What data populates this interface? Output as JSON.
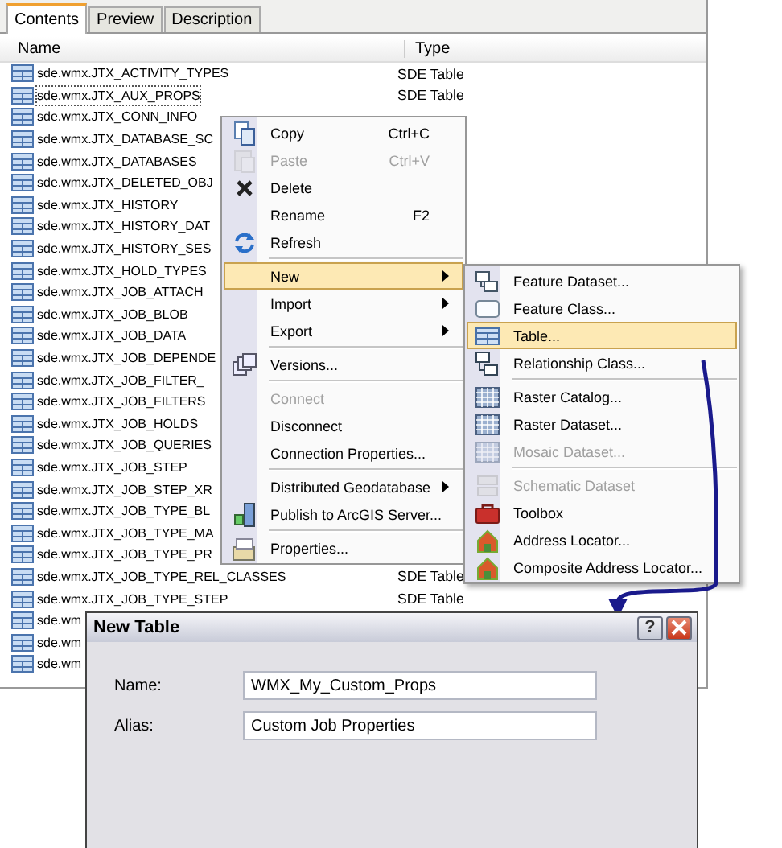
{
  "explorer": {
    "tabs": [
      {
        "label": "Contents",
        "selected": true
      },
      {
        "label": "Preview",
        "selected": false
      },
      {
        "label": "Description",
        "selected": false
      }
    ],
    "columns": [
      "Name",
      "Type"
    ],
    "rows": [
      {
        "name": "sde.wmx.JTX_ACTIVITY_TYPES",
        "type": "SDE Table",
        "focused": false
      },
      {
        "name": "sde.wmx.JTX_AUX_PROPS",
        "type": "SDE Table",
        "focused": true
      },
      {
        "name": "sde.wmx.JTX_CONN_INFO",
        "focused": false
      },
      {
        "name": "sde.wmx.JTX_DATABASE_SC",
        "focused": false
      },
      {
        "name": "sde.wmx.JTX_DATABASES",
        "focused": false
      },
      {
        "name": "sde.wmx.JTX_DELETED_OBJ",
        "focused": false
      },
      {
        "name": "sde.wmx.JTX_HISTORY",
        "focused": false
      },
      {
        "name": "sde.wmx.JTX_HISTORY_DAT",
        "focused": false
      },
      {
        "name": "sde.wmx.JTX_HISTORY_SES",
        "focused": false
      },
      {
        "name": "sde.wmx.JTX_HOLD_TYPES",
        "focused": false
      },
      {
        "name": "sde.wmx.JTX_JOB_ATTACH",
        "focused": false
      },
      {
        "name": "sde.wmx.JTX_JOB_BLOB",
        "focused": false
      },
      {
        "name": "sde.wmx.JTX_JOB_DATA",
        "focused": false
      },
      {
        "name": "sde.wmx.JTX_JOB_DEPENDE",
        "focused": false
      },
      {
        "name": "sde.wmx.JTX_JOB_FILTER_",
        "focused": false
      },
      {
        "name": "sde.wmx.JTX_JOB_FILTERS",
        "focused": false
      },
      {
        "name": "sde.wmx.JTX_JOB_HOLDS",
        "focused": false
      },
      {
        "name": "sde.wmx.JTX_JOB_QUERIES",
        "focused": false
      },
      {
        "name": "sde.wmx.JTX_JOB_STEP",
        "focused": false
      },
      {
        "name": "sde.wmx.JTX_JOB_STEP_XR",
        "focused": false
      },
      {
        "name": "sde.wmx.JTX_JOB_TYPE_BL",
        "focused": false
      },
      {
        "name": "sde.wmx.JTX_JOB_TYPE_MA",
        "focused": false
      },
      {
        "name": "sde.wmx.JTX_JOB_TYPE_PR",
        "focused": false
      },
      {
        "name": "sde.wmx.JTX_JOB_TYPE_REL_CLASSES",
        "type": "SDE Table",
        "focused": false
      },
      {
        "name": "sde.wmx.JTX_JOB_TYPE_STEP",
        "type": "SDE Table",
        "focused": false
      },
      {
        "name": "sde.wm",
        "focused": false
      },
      {
        "name": "sde.wm",
        "focused": false
      },
      {
        "name": "sde.wm",
        "focused": false
      }
    ]
  },
  "context_menu": {
    "items": [
      {
        "kind": "item",
        "label": "Copy",
        "shortcut": "Ctrl+C",
        "disabled": false,
        "selected": false,
        "submenu": false
      },
      {
        "kind": "item",
        "label": "Paste",
        "shortcut": "Ctrl+V",
        "disabled": true,
        "selected": false,
        "submenu": false
      },
      {
        "kind": "item",
        "label": "Delete",
        "disabled": false,
        "selected": false,
        "submenu": false
      },
      {
        "kind": "item",
        "label": "Rename",
        "shortcut": "F2",
        "disabled": false,
        "selected": false,
        "submenu": false
      },
      {
        "kind": "item",
        "label": "Refresh",
        "disabled": false,
        "selected": false,
        "submenu": false
      },
      {
        "kind": "separator"
      },
      {
        "kind": "item",
        "label": "New",
        "disabled": false,
        "selected": true,
        "submenu": true
      },
      {
        "kind": "item",
        "label": "Import",
        "disabled": false,
        "selected": false,
        "submenu": true
      },
      {
        "kind": "item",
        "label": "Export",
        "disabled": false,
        "selected": false,
        "submenu": true
      },
      {
        "kind": "separator"
      },
      {
        "kind": "item",
        "label": "Versions...",
        "disabled": false,
        "selected": false,
        "submenu": false
      },
      {
        "kind": "separator"
      },
      {
        "kind": "item",
        "label": "Connect",
        "disabled": true,
        "selected": false,
        "submenu": false
      },
      {
        "kind": "item",
        "label": "Disconnect",
        "disabled": false,
        "selected": false,
        "submenu": false
      },
      {
        "kind": "item",
        "label": "Connection Properties...",
        "disabled": false,
        "selected": false,
        "submenu": false
      },
      {
        "kind": "separator"
      },
      {
        "kind": "item",
        "label": "Distributed Geodatabase",
        "disabled": false,
        "selected": false,
        "submenu": true
      },
      {
        "kind": "item",
        "label": "Publish to ArcGIS Server...",
        "disabled": false,
        "selected": false,
        "submenu": false
      },
      {
        "kind": "separator"
      },
      {
        "kind": "item",
        "label": "Properties...",
        "disabled": false,
        "selected": false,
        "submenu": false
      }
    ]
  },
  "submenu": {
    "items": [
      {
        "kind": "item",
        "label": "Feature Dataset...",
        "disabled": false,
        "selected": false
      },
      {
        "kind": "item",
        "label": "Feature Class...",
        "disabled": false,
        "selected": false
      },
      {
        "kind": "item",
        "label": "Table...",
        "disabled": false,
        "selected": true
      },
      {
        "kind": "item",
        "label": "Relationship Class...",
        "disabled": false,
        "selected": false
      },
      {
        "kind": "separator"
      },
      {
        "kind": "item",
        "label": "Raster Catalog...",
        "disabled": false,
        "selected": false
      },
      {
        "kind": "item",
        "label": "Raster Dataset...",
        "disabled": false,
        "selected": false
      },
      {
        "kind": "item",
        "label": "Mosaic Dataset...",
        "disabled": true,
        "selected": false
      },
      {
        "kind": "separator"
      },
      {
        "kind": "item",
        "label": "Schematic Dataset",
        "disabled": true,
        "selected": false
      },
      {
        "kind": "item",
        "label": "Toolbox",
        "disabled": false,
        "selected": false
      },
      {
        "kind": "item",
        "label": "Address Locator...",
        "disabled": false,
        "selected": false
      },
      {
        "kind": "item",
        "label": "Composite Address Locator...",
        "disabled": false,
        "selected": false
      }
    ]
  },
  "dialog": {
    "title": "New Table",
    "help_button": "?",
    "fields": [
      {
        "label": "Name:",
        "value": "WMX_My_Custom_Props"
      },
      {
        "label": "Alias:",
        "value": "Custom Job Properties"
      }
    ]
  }
}
